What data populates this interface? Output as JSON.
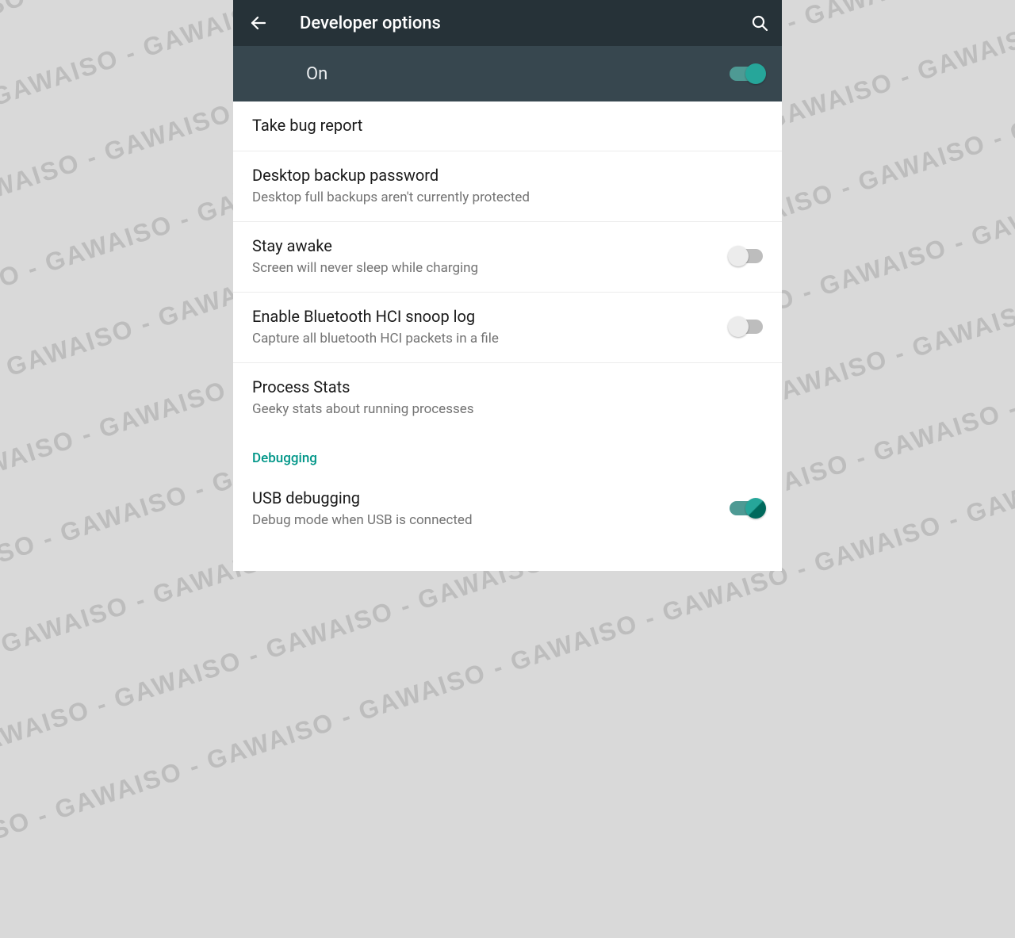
{
  "watermark": "GAWAISO",
  "appbar": {
    "title": "Developer options"
  },
  "master_toggle": {
    "label": "On",
    "on": true
  },
  "items": [
    {
      "title": "Take bug report",
      "subtitle": null,
      "toggle": null
    },
    {
      "title": "Desktop backup password",
      "subtitle": "Desktop full backups aren't currently protected",
      "toggle": null
    },
    {
      "title": "Stay awake",
      "subtitle": "Screen will never sleep while charging",
      "toggle": false
    },
    {
      "title": "Enable Bluetooth HCI snoop log",
      "subtitle": "Capture all bluetooth HCI packets in a file",
      "toggle": false
    },
    {
      "title": "Process Stats",
      "subtitle": "Geeky stats about running processes",
      "toggle": null
    }
  ],
  "sections": {
    "debugging": {
      "header": "Debugging",
      "items": [
        {
          "title": "USB debugging",
          "subtitle": "Debug mode when USB is connected",
          "toggle": true
        }
      ]
    }
  }
}
